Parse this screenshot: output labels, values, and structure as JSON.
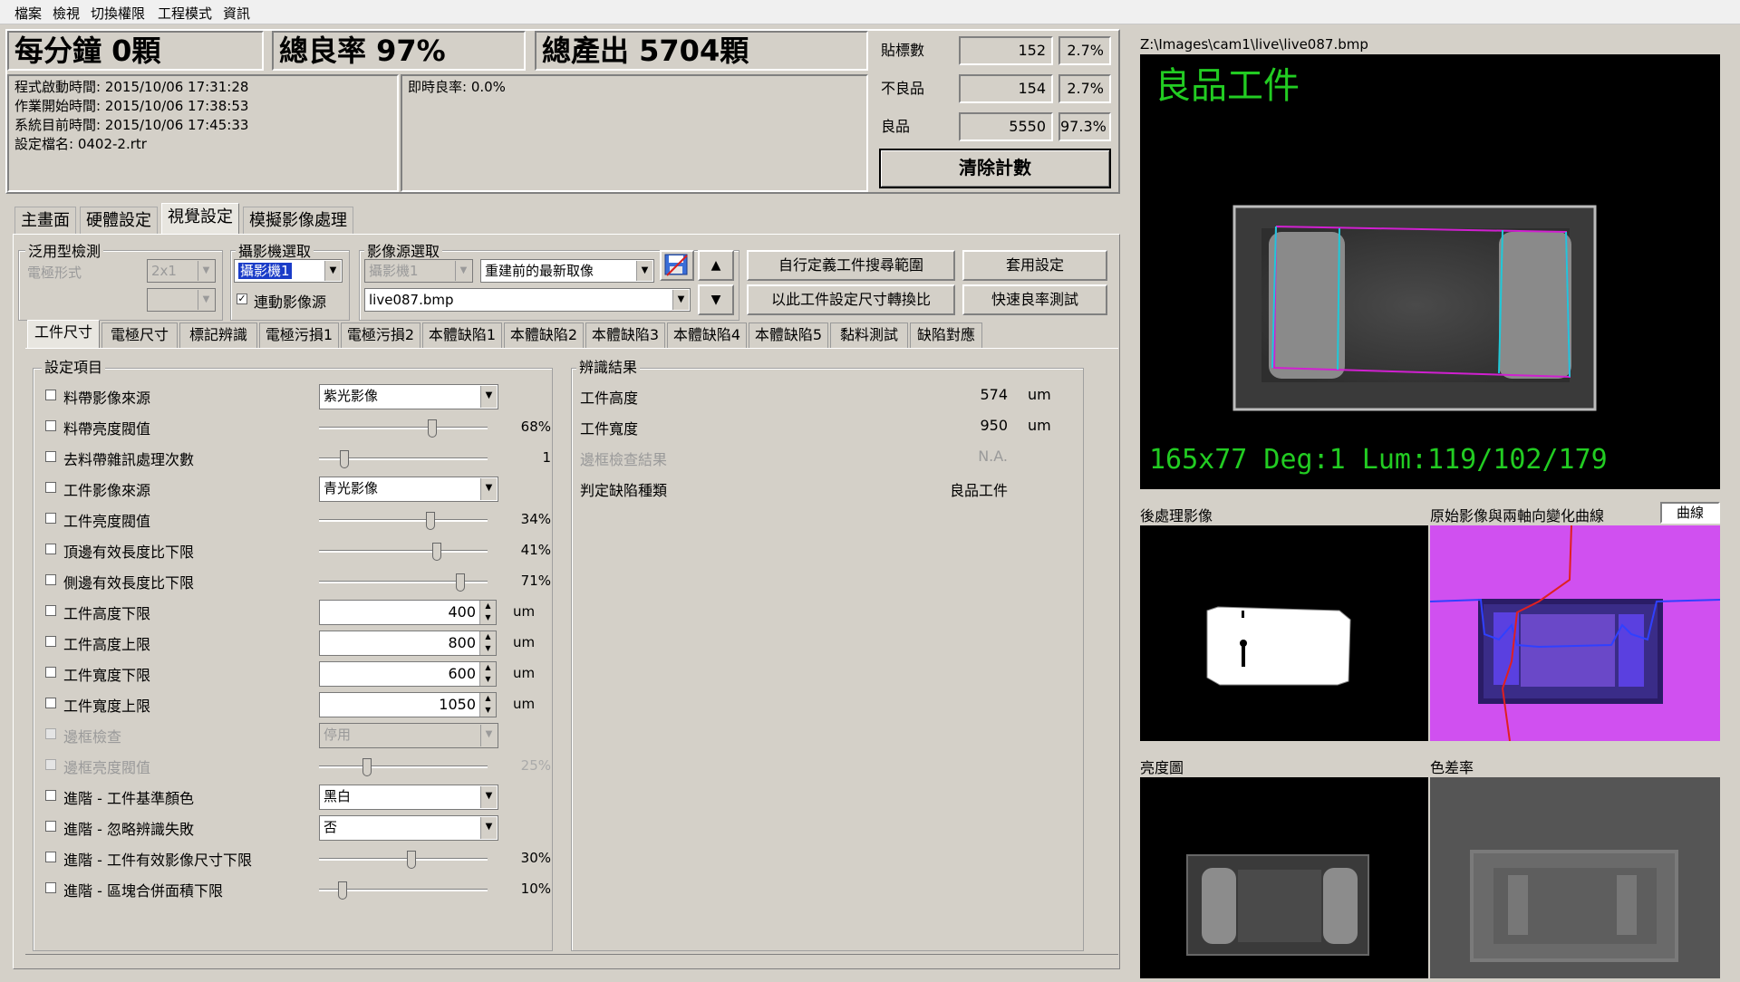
{
  "menu": [
    "檔案",
    "檢視",
    "切換權限",
    "工程模式",
    "資訊"
  ],
  "stats": {
    "per_minute": "每分鐘 0顆",
    "yield": "總良率 97%",
    "output": "總產出 5704顆"
  },
  "info": {
    "start": "程式啟動時間: 2015/10/06 17:31:28",
    "job_start": "作業開始時間: 2015/10/06 17:38:53",
    "now": "系統目前時間: 2015/10/06 17:45:33",
    "config": "設定檔名: 0402-2.rtr",
    "realtime_yield": "即時良率: 0.0%"
  },
  "counts": [
    {
      "label": "貼標數",
      "value": "152",
      "pct": "2.7%"
    },
    {
      "label": "不良品",
      "value": "154",
      "pct": "2.7%"
    },
    {
      "label": "良品",
      "value": "5550",
      "pct": "97.3%"
    }
  ],
  "clear_button": "清除計數",
  "tabs": [
    "主畫面",
    "硬體設定",
    "視覺設定",
    "模擬影像處理"
  ],
  "active_tab": 2,
  "general": {
    "title": "泛用型檢測",
    "electrode_label": "電極形式",
    "electrode_value": "2x1"
  },
  "camera": {
    "title": "攝影機選取",
    "value": "攝影機1",
    "link_label": "連動影像源"
  },
  "source": {
    "title": "影像源選取",
    "camera": "攝影機1",
    "mode": "重建前的最新取像",
    "file": "live087.bmp"
  },
  "buttons": {
    "custom_search": "自行定義工件搜尋範圍",
    "apply": "套用設定",
    "convert": "以此工件設定尺寸轉換比",
    "quick_test": "快速良率測試",
    "up": "▲",
    "down": "▼"
  },
  "subtabs": [
    "工件尺寸",
    "電極尺寸",
    "標記辨識",
    "電極污損1",
    "電極污損2",
    "本體缺陷1",
    "本體缺陷2",
    "本體缺陷3",
    "本體缺陷4",
    "本體缺陷5",
    "黏料測試",
    "缺陷對應"
  ],
  "settings_title": "設定項目",
  "settings": [
    {
      "label": "料帶影像來源",
      "type": "combo",
      "value": "紫光影像"
    },
    {
      "label": "料帶亮度閥值",
      "type": "slider",
      "value": 0.68,
      "text": "68%"
    },
    {
      "label": "去料帶雜訊處理次數",
      "type": "slider",
      "value": 0.13,
      "text": "1"
    },
    {
      "label": "工件影像來源",
      "type": "combo",
      "value": "青光影像"
    },
    {
      "label": "工件亮度閥值",
      "type": "slider",
      "value": 0.67,
      "text": "34%"
    },
    {
      "label": "頂邊有效長度比下限",
      "type": "slider",
      "value": 0.71,
      "text": "41%"
    },
    {
      "label": "側邊有效長度比下限",
      "type": "slider",
      "value": 0.86,
      "text": "71%"
    },
    {
      "label": "工件高度下限",
      "type": "spin",
      "value": "400",
      "unit": "um"
    },
    {
      "label": "工件高度上限",
      "type": "spin",
      "value": "800",
      "unit": "um"
    },
    {
      "label": "工件寬度下限",
      "type": "spin",
      "value": "600",
      "unit": "um"
    },
    {
      "label": "工件寬度上限",
      "type": "spin",
      "value": "1050",
      "unit": "um"
    },
    {
      "label": "邊框檢查",
      "type": "combo",
      "value": "停用",
      "disabled": true
    },
    {
      "label": "邊框亮度閥值",
      "type": "slider",
      "value": 0.27,
      "text": "25%",
      "disabled": true
    },
    {
      "label": "進階 - 工件基準顏色",
      "type": "combo",
      "value": "黑白"
    },
    {
      "label": "進階 - 忽略辨識失敗",
      "type": "combo",
      "value": "否"
    },
    {
      "label": "進階 - 工件有效影像尺寸下限",
      "type": "slider",
      "value": 0.55,
      "text": "30%"
    },
    {
      "label": "進階 - 區塊合併面積下限",
      "type": "slider",
      "value": 0.12,
      "text": "10%"
    }
  ],
  "results_title": "辨識結果",
  "results": [
    {
      "label": "工件高度",
      "value": "574",
      "unit": "um"
    },
    {
      "label": "工件寬度",
      "value": "950",
      "unit": "um"
    },
    {
      "label": "邊框檢查結果",
      "value": "N.A.",
      "unit": "",
      "disabled": true
    },
    {
      "label": "判定缺陷種類",
      "value": "良品工件",
      "unit": ""
    }
  ],
  "image": {
    "path": "Z:\\Images\\cam1\\live\\live087.bmp",
    "result_text": "良品工件",
    "overlay_info": "165x77 Deg:1 Lum:119/102/179"
  },
  "panels": {
    "post": "後處理影像",
    "curve": "原始影像與兩軸向變化曲線",
    "curve_button": "曲線",
    "brightness": "亮度圖",
    "color_diff": "色差率"
  },
  "colors": {
    "overlay_green": "#22cc22",
    "cyan": "#20c8d8",
    "magenta": "#d020d0"
  }
}
